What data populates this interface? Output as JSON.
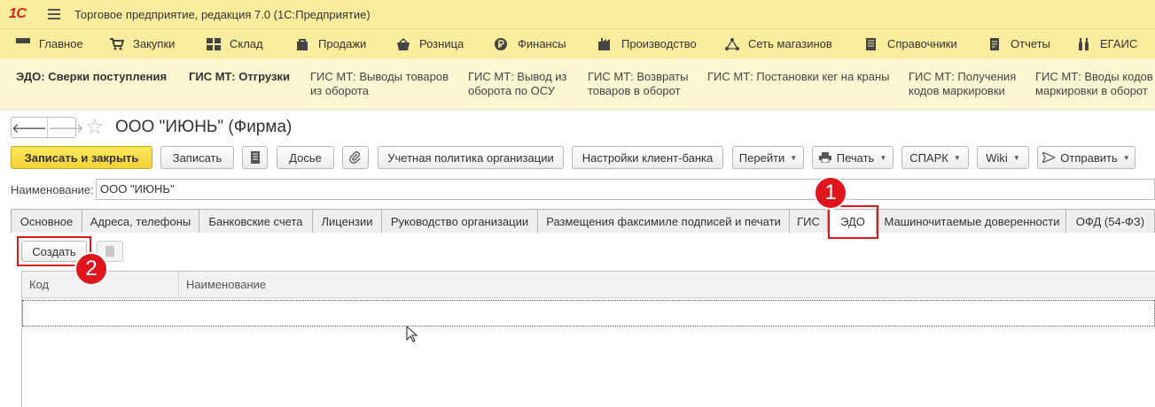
{
  "app": {
    "logo": "1С",
    "title": "Торговое предприятие, редакция 7.0  (1С:Предприятие)"
  },
  "sections": [
    {
      "label": "Главное",
      "icon": "menu-icon"
    },
    {
      "label": "Закупки",
      "icon": "cart-icon"
    },
    {
      "label": "Склад",
      "icon": "warehouse-icon"
    },
    {
      "label": "Продажи",
      "icon": "bag-icon"
    },
    {
      "label": "Розница",
      "icon": "basket-icon"
    },
    {
      "label": "Финансы",
      "icon": "ruble-icon"
    },
    {
      "label": "Производство",
      "icon": "factory-icon"
    },
    {
      "label": "Сеть магазинов",
      "icon": "network-icon"
    },
    {
      "label": "Справочники",
      "icon": "book-icon"
    },
    {
      "label": "Отчеты",
      "icon": "report-icon"
    },
    {
      "label": "ЕГАИС",
      "icon": "bottles-icon"
    }
  ],
  "subnav": [
    {
      "line1": "ЭДО: Сверки поступления",
      "line2": ""
    },
    {
      "line1": "ГИС МТ: Отгрузки",
      "line2": ""
    },
    {
      "line1": "ГИС МТ: Выводы товаров",
      "line2": "из оборота"
    },
    {
      "line1": "ГИС МТ: Вывод из",
      "line2": "оборота по ОСУ"
    },
    {
      "line1": "ГИС МТ: Возвраты",
      "line2": "товаров в оборот"
    },
    {
      "line1": "ГИС МТ: Постановки кег на краны",
      "line2": ""
    },
    {
      "line1": "ГИС МТ: Получения",
      "line2": "кодов маркировки"
    },
    {
      "line1": "ГИС МТ: Вводы кодов",
      "line2": "маркировки в оборот"
    }
  ],
  "form": {
    "title": "ООО \"ИЮНЬ\" (Фирма)",
    "back_glyph": "🡐",
    "forward_glyph": "🡒",
    "star_glyph": "☆"
  },
  "toolbar": {
    "save_close": "Записать и закрыть",
    "save": "Записать",
    "dossier": "Досье",
    "accounting_policy": "Учетная политика организации",
    "bank_client": "Настройки клиент-банка",
    "goto": "Перейти",
    "print": "Печать",
    "spark": "СПАРК",
    "wiki": "Wiki",
    "send": "Отправить"
  },
  "name_field": {
    "label": "Наименование:",
    "value": "ООО \"ИЮНЬ\""
  },
  "tabs": [
    {
      "label": "Основное"
    },
    {
      "label": "Адреса, телефоны"
    },
    {
      "label": "Банковские счета"
    },
    {
      "label": "Лицензии"
    },
    {
      "label": "Руководство организации"
    },
    {
      "label": "Размещения факсимиле подписей и печати"
    },
    {
      "label": "ГИС"
    },
    {
      "label": "ЭДО",
      "active": true
    },
    {
      "label": "Машиночитаемые доверенности"
    },
    {
      "label": "ОФД (54-ФЗ)"
    }
  ],
  "edo": {
    "create": "Создать",
    "columns": [
      "Код",
      "Наименование"
    ]
  },
  "callouts": [
    "1",
    "2"
  ],
  "colors": {
    "header_bg": "#fbed9e",
    "subnav_bg": "#fdf6d3",
    "primary_button": "#f3d23a",
    "callout": "#e0161d",
    "logo": "#d4241d"
  }
}
